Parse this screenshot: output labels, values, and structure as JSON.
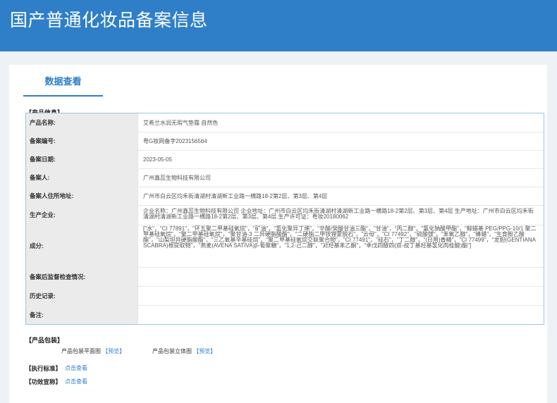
{
  "header": {
    "title": "国产普通化妆品备案信息"
  },
  "tabs": {
    "active": "数据查看"
  },
  "product_info": {
    "section_title": "【产品信息】",
    "rows": [
      {
        "label": "产品名称:",
        "value": "艾希兰水润无瑕气垫霜 自然色"
      },
      {
        "label": "备案编号:",
        "value": "粤G妆网备字2023156564"
      },
      {
        "label": "备案日期:",
        "value": "2023-05-05"
      },
      {
        "label": "备案人:",
        "value": "广州鑫蕊生物科技有限公司"
      },
      {
        "label": "备案人住所地址:",
        "value": "广州市白云区均禾街清湖村清湖新工业路一横路18-2第2层、第3层、第4层"
      },
      {
        "label": "生产企业:",
        "value": "企业名称：广州鑫蕊生物科技有限公司 企业地址：广州市白云区均禾街清湖村清湖新工业路一横路18-2第2层、第3层、第4层 生产地址：广州市白云区均禾街清湖村清湖新工业路一横路18-2第2层、第3层、第4层 生产许可证：粤妆20180062"
      },
      {
        "label": "成分:",
        "value": "[\"水\"，\"CI 77891\"，\"环五聚二甲基硅氧烷\"，\"矿油\"，\"氢化聚异丁烯\"，\"辛酸/癸酸甘油三酯\"，\"甘油\"，\"丙二醇\"，\"氯化钠酸甲酯\"，\"鲸蜡基 PEG/PPG-10/1 聚二甲基硅氧烷\"，\"聚二甲基硅氧烷\"，\"聚甘油-3 二异硬脂酸酯\"，\"二硬脂二甲铵锂蒙脱石\"，\"云母\"，\"CI 77492\"，\"硫酸镁\"，\"苯氧乙醇\"，\"蜂蜡\"，\"生育酚乙酸酯\"，\"山梨坦异硬脂酸酯\"，\"三乙氧基辛基硅烷\"，\"聚二甲基硅氧烷交联聚合物\"，\"CI 77491\"，\"硅石\"，\"丁二醇\"，\"(日用)香精\"，\"CI 77499\"，\"龙胆(GENTIANA SCABRA)根提取物\"，\"燕麦(AVENA SATIVA)β-葡聚糖\"，\"1,2-己二醇\"，\"对羟基苯乙酮\"，\"季戊四醇四(双-叔丁基羟基氢化肉桂酸)酯\"]"
      },
      {
        "label": "备案后监督检查情况:",
        "value": ""
      },
      {
        "label": "历史记录:",
        "value": ""
      },
      {
        "label": "备注:",
        "value": ""
      }
    ]
  },
  "packaging": {
    "section_title": "【产品包装】",
    "items": [
      {
        "label": "产品包装平面图",
        "link": "【预览】"
      },
      {
        "label": "产品包装立体图",
        "link": "【预览】"
      }
    ]
  },
  "standard": {
    "title": "【执行标准】",
    "link": "点击查看"
  },
  "efficacy": {
    "title": "【功效宣称】",
    "link": "点击查看"
  }
}
